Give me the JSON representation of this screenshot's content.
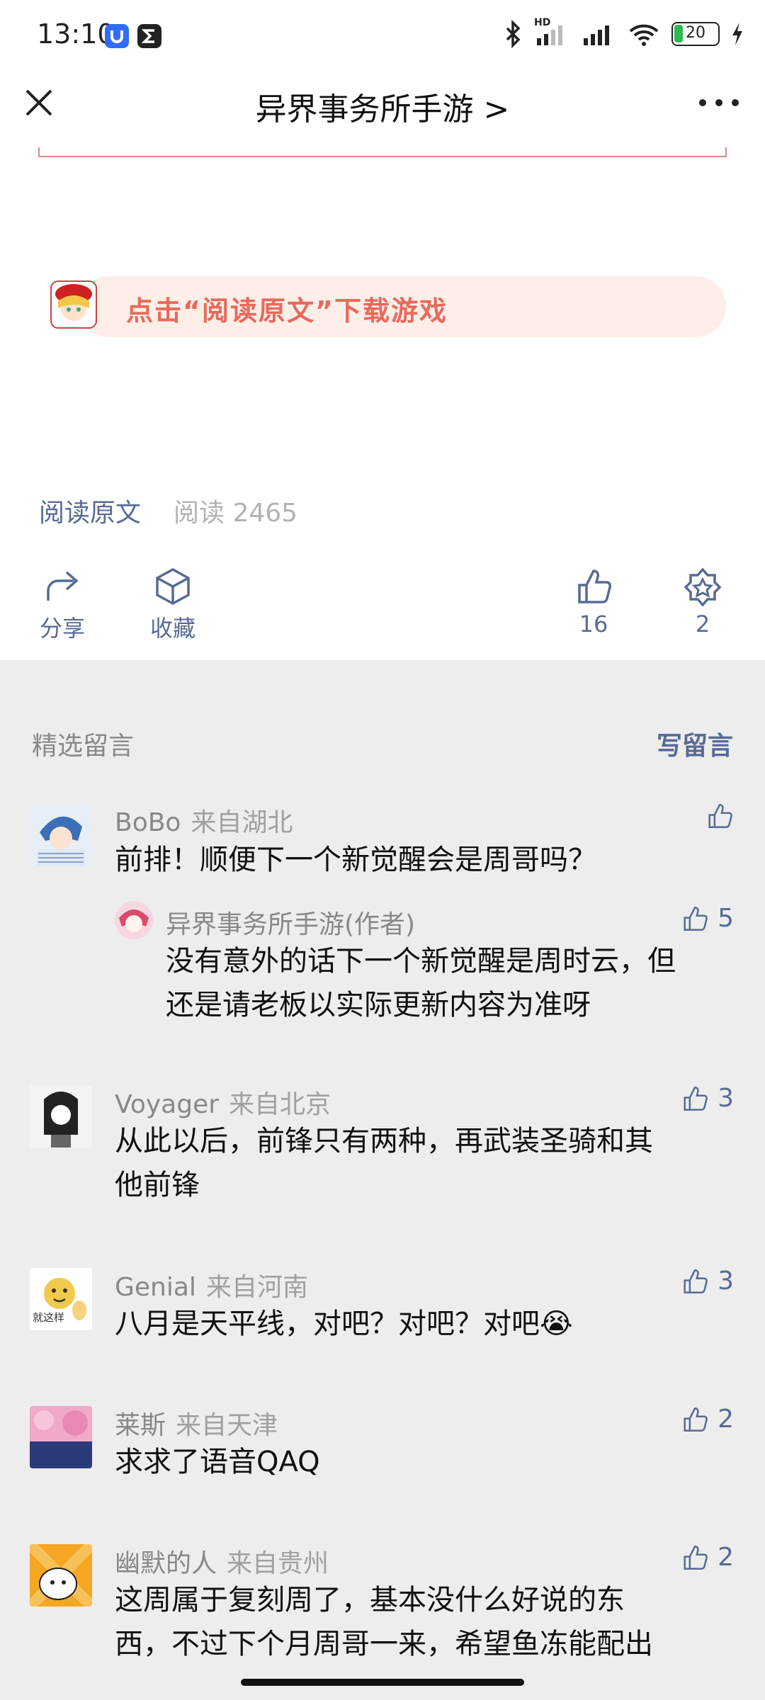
{
  "status": {
    "time": "13:10",
    "battery": "20",
    "network_label": "HD"
  },
  "header": {
    "title": "异界事务所手游 >"
  },
  "banner": {
    "text": "点击“阅读原文”下载游戏"
  },
  "read_row": {
    "read_original": "阅读原文",
    "read_count": "阅读 2465"
  },
  "actions": {
    "share": "分享",
    "favorite": "收藏",
    "like_count": "16",
    "wow_count": "2"
  },
  "comments_section": {
    "title": "精选留言",
    "write": "写留言"
  },
  "comments": [
    {
      "name": "BoBo",
      "location": "来自湖北",
      "text": "前排！顺便下一个新觉醒会是周哥吗？",
      "likes": "",
      "reply": {
        "name": "异界事务所手游(作者)",
        "text_line1": "没有意外的话下一个新觉醒是周时云，但",
        "text_line2": "还是请老板以实际更新内容为准呀",
        "likes": "5"
      }
    },
    {
      "name": "Voyager",
      "location": "来自北京",
      "text_line1": "从此以后，前锋只有两种，再武装圣骑和其",
      "text_line2": "他前锋",
      "likes": "3"
    },
    {
      "name": "Genial",
      "location": "来自河南",
      "text": "八月是天平线，对吧？对吧？对吧😭",
      "likes": "3",
      "avatar_text": "就这样"
    },
    {
      "name": "莱斯",
      "location": "来自天津",
      "text": "求求了语音QAQ",
      "likes": "2"
    },
    {
      "name": "幽默的人",
      "location": "来自贵州",
      "text_line1": "这周属于复刻周了，基本没什么好说的东",
      "text_line2": "西，不过下个月周哥一来，希望鱼冻能配出",
      "likes": "2"
    }
  ],
  "colors": {
    "link": "#576b95",
    "banner_bg": "#fdeee8",
    "banner_text": "#e86a5c",
    "comments_bg": "#ededed"
  }
}
